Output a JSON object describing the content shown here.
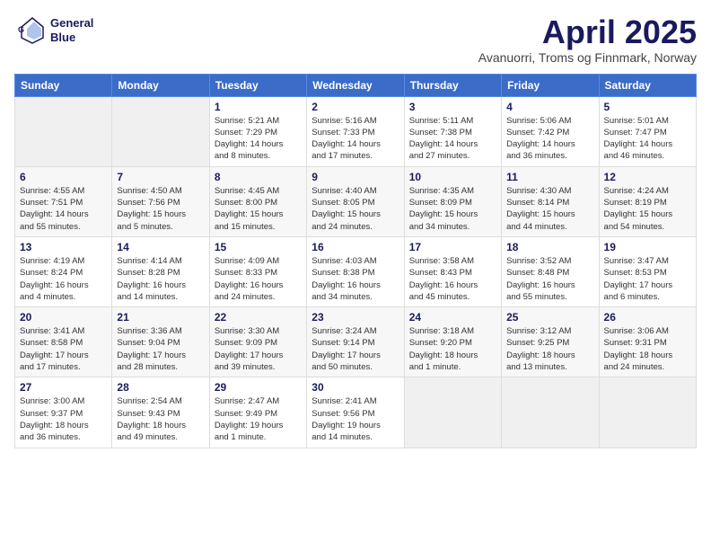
{
  "header": {
    "logo_line1": "General",
    "logo_line2": "Blue",
    "title": "April 2025",
    "subtitle": "Avanuorri, Troms og Finnmark, Norway"
  },
  "weekdays": [
    "Sunday",
    "Monday",
    "Tuesday",
    "Wednesday",
    "Thursday",
    "Friday",
    "Saturday"
  ],
  "weeks": [
    [
      {
        "day": "",
        "info": ""
      },
      {
        "day": "",
        "info": ""
      },
      {
        "day": "1",
        "info": "Sunrise: 5:21 AM\nSunset: 7:29 PM\nDaylight: 14 hours\nand 8 minutes."
      },
      {
        "day": "2",
        "info": "Sunrise: 5:16 AM\nSunset: 7:33 PM\nDaylight: 14 hours\nand 17 minutes."
      },
      {
        "day": "3",
        "info": "Sunrise: 5:11 AM\nSunset: 7:38 PM\nDaylight: 14 hours\nand 27 minutes."
      },
      {
        "day": "4",
        "info": "Sunrise: 5:06 AM\nSunset: 7:42 PM\nDaylight: 14 hours\nand 36 minutes."
      },
      {
        "day": "5",
        "info": "Sunrise: 5:01 AM\nSunset: 7:47 PM\nDaylight: 14 hours\nand 46 minutes."
      }
    ],
    [
      {
        "day": "6",
        "info": "Sunrise: 4:55 AM\nSunset: 7:51 PM\nDaylight: 14 hours\nand 55 minutes."
      },
      {
        "day": "7",
        "info": "Sunrise: 4:50 AM\nSunset: 7:56 PM\nDaylight: 15 hours\nand 5 minutes."
      },
      {
        "day": "8",
        "info": "Sunrise: 4:45 AM\nSunset: 8:00 PM\nDaylight: 15 hours\nand 15 minutes."
      },
      {
        "day": "9",
        "info": "Sunrise: 4:40 AM\nSunset: 8:05 PM\nDaylight: 15 hours\nand 24 minutes."
      },
      {
        "day": "10",
        "info": "Sunrise: 4:35 AM\nSunset: 8:09 PM\nDaylight: 15 hours\nand 34 minutes."
      },
      {
        "day": "11",
        "info": "Sunrise: 4:30 AM\nSunset: 8:14 PM\nDaylight: 15 hours\nand 44 minutes."
      },
      {
        "day": "12",
        "info": "Sunrise: 4:24 AM\nSunset: 8:19 PM\nDaylight: 15 hours\nand 54 minutes."
      }
    ],
    [
      {
        "day": "13",
        "info": "Sunrise: 4:19 AM\nSunset: 8:24 PM\nDaylight: 16 hours\nand 4 minutes."
      },
      {
        "day": "14",
        "info": "Sunrise: 4:14 AM\nSunset: 8:28 PM\nDaylight: 16 hours\nand 14 minutes."
      },
      {
        "day": "15",
        "info": "Sunrise: 4:09 AM\nSunset: 8:33 PM\nDaylight: 16 hours\nand 24 minutes."
      },
      {
        "day": "16",
        "info": "Sunrise: 4:03 AM\nSunset: 8:38 PM\nDaylight: 16 hours\nand 34 minutes."
      },
      {
        "day": "17",
        "info": "Sunrise: 3:58 AM\nSunset: 8:43 PM\nDaylight: 16 hours\nand 45 minutes."
      },
      {
        "day": "18",
        "info": "Sunrise: 3:52 AM\nSunset: 8:48 PM\nDaylight: 16 hours\nand 55 minutes."
      },
      {
        "day": "19",
        "info": "Sunrise: 3:47 AM\nSunset: 8:53 PM\nDaylight: 17 hours\nand 6 minutes."
      }
    ],
    [
      {
        "day": "20",
        "info": "Sunrise: 3:41 AM\nSunset: 8:58 PM\nDaylight: 17 hours\nand 17 minutes."
      },
      {
        "day": "21",
        "info": "Sunrise: 3:36 AM\nSunset: 9:04 PM\nDaylight: 17 hours\nand 28 minutes."
      },
      {
        "day": "22",
        "info": "Sunrise: 3:30 AM\nSunset: 9:09 PM\nDaylight: 17 hours\nand 39 minutes."
      },
      {
        "day": "23",
        "info": "Sunrise: 3:24 AM\nSunset: 9:14 PM\nDaylight: 17 hours\nand 50 minutes."
      },
      {
        "day": "24",
        "info": "Sunrise: 3:18 AM\nSunset: 9:20 PM\nDaylight: 18 hours\nand 1 minute."
      },
      {
        "day": "25",
        "info": "Sunrise: 3:12 AM\nSunset: 9:25 PM\nDaylight: 18 hours\nand 13 minutes."
      },
      {
        "day": "26",
        "info": "Sunrise: 3:06 AM\nSunset: 9:31 PM\nDaylight: 18 hours\nand 24 minutes."
      }
    ],
    [
      {
        "day": "27",
        "info": "Sunrise: 3:00 AM\nSunset: 9:37 PM\nDaylight: 18 hours\nand 36 minutes."
      },
      {
        "day": "28",
        "info": "Sunrise: 2:54 AM\nSunset: 9:43 PM\nDaylight: 18 hours\nand 49 minutes."
      },
      {
        "day": "29",
        "info": "Sunrise: 2:47 AM\nSunset: 9:49 PM\nDaylight: 19 hours\nand 1 minute."
      },
      {
        "day": "30",
        "info": "Sunrise: 2:41 AM\nSunset: 9:56 PM\nDaylight: 19 hours\nand 14 minutes."
      },
      {
        "day": "",
        "info": ""
      },
      {
        "day": "",
        "info": ""
      },
      {
        "day": "",
        "info": ""
      }
    ]
  ]
}
